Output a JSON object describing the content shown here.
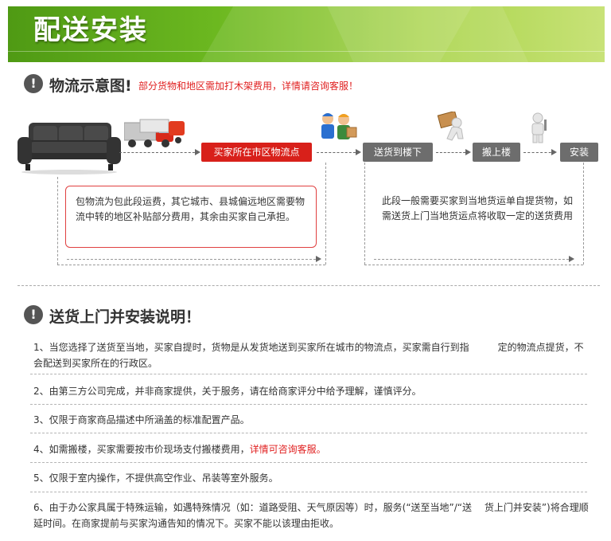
{
  "banner": {
    "title": "配送安装"
  },
  "section1": {
    "title": "物流示意图!",
    "note": "部分货物和地区需加打木架费用，详情请咨询客服！",
    "steps": [
      "买家所在市区物流点",
      "送货到楼下",
      "搬上楼",
      "安装"
    ],
    "info_left": "包物流为包此段运费，其它城市、县城偏远地区需要物流中转的地区补贴部分费用，其余由买家自己承担。",
    "info_right": "此段一般需要买家到当地货运单自提货物，如需送货上门当地货运点将收取一定的送货费用"
  },
  "section2": {
    "title": "送货上门并安装说明！",
    "items": [
      {
        "text": "1、当您选择了送货至当地，买家自提时，货物是从发货地送到买家所在城市的物流点，买家需自行到指　　　定的物流点提货，不会配送到买家所在的行政区。"
      },
      {
        "text": "2、由第三方公司完成，并非商家提供，关于服务，请在给商家评分中给予理解，谨慎评分。"
      },
      {
        "text": "3、仅限于商家商品描述中所涵盖的标准配置产品。"
      },
      {
        "text": "4、如需搬楼，买家需要按市价现场支付搬楼费用，",
        "highlight": "详情可咨询客服。"
      },
      {
        "text": "5、仅限于室内操作，不提供高空作业、吊装等室外服务。"
      },
      {
        "text": "6、由于办公家具属于特殊运输，如遇特殊情况（如：道路受阻、天气原因等）时，服务(“送至当地”/“送　 货上门并安装”)将合理顺延时间。在商家提前与买家沟通告知的情况下。买家不能以该理由拒收。"
      }
    ]
  },
  "colors": {
    "accent_green": "#6cb820",
    "accent_red": "#d8201a",
    "step_gray": "#6d6d6d"
  }
}
